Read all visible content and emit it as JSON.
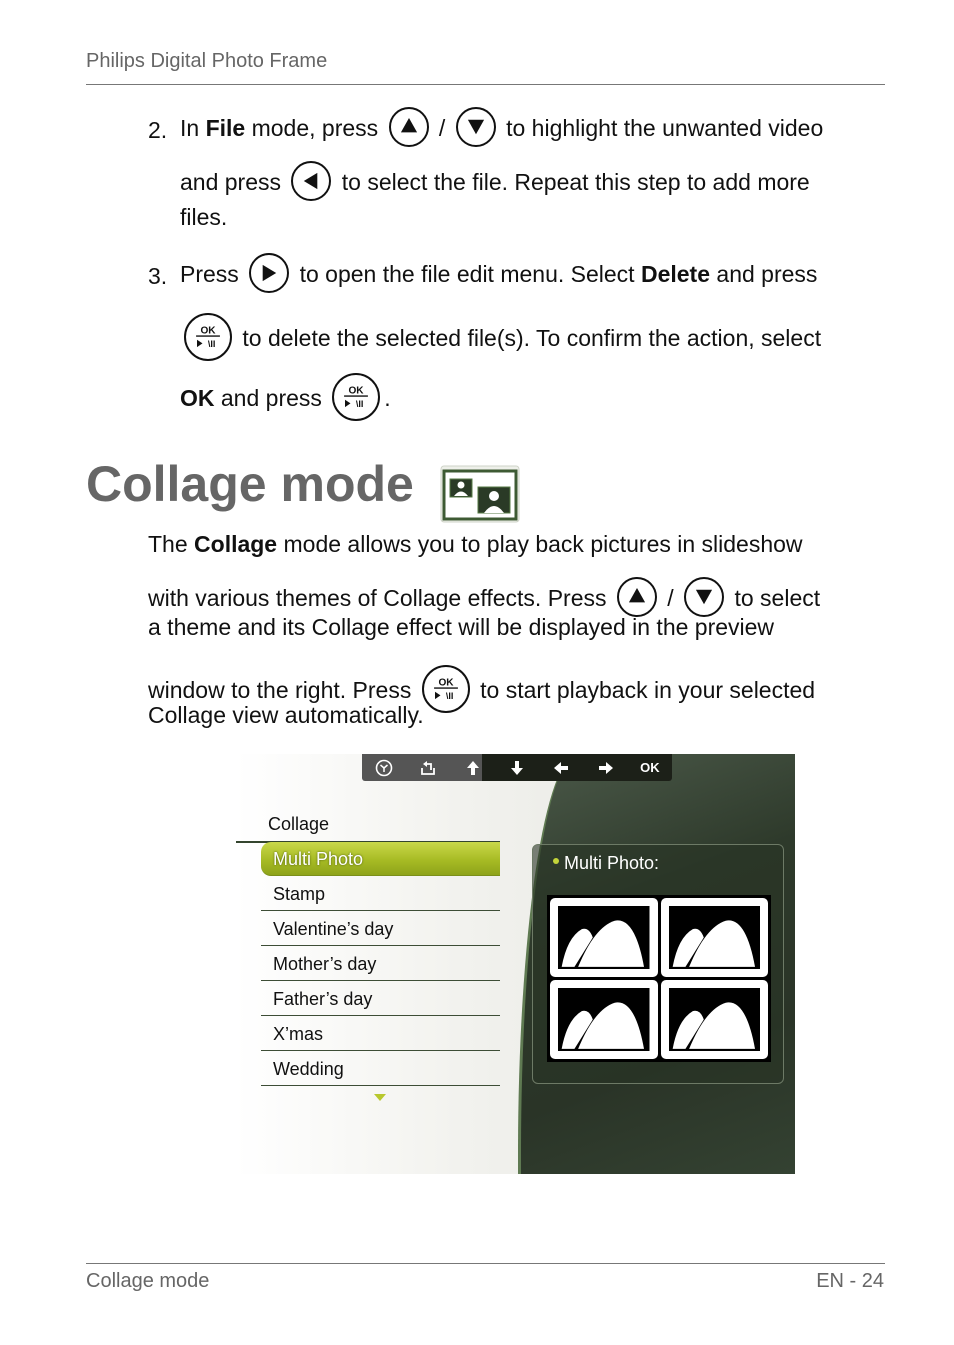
{
  "header": {
    "title": "Philips Digital Photo Frame"
  },
  "steps": [
    {
      "number": "2.",
      "line1": {
        "a": "In ",
        "b_bold": "File",
        "c": " mode, press ",
        "sep": " / ",
        "d": " to highlight the unwanted video"
      },
      "line2": {
        "a": "and press ",
        "b": " to select the file. Repeat this step to add more"
      },
      "line3": "files."
    },
    {
      "number": "3.",
      "line1": {
        "a": "Press ",
        "b": " to open the file edit menu. Select ",
        "c_bold": "Delete",
        "d": " and press"
      },
      "line2": " to delete the selected file(s). To confirm the action, select",
      "line3": {
        "a_bold": "OK",
        "b": " and press ",
        "c": "."
      }
    }
  ],
  "section": {
    "title": "Collage mode",
    "icon": "collage-mode-icon",
    "para": {
      "l1a": "The ",
      "l1b_bold": "Collage",
      "l1c": " mode allows you to play back pictures in slideshow",
      "l2a": "with various themes of Collage effects. Press ",
      "l2sep": " / ",
      "l2b": " to select",
      "l3": "a theme and its Collage effect will be displayed in the preview",
      "l4a": "window to the right. Press ",
      "l4b": " to start playback in your selected",
      "l5": "Collage view automatically."
    }
  },
  "buttons": {
    "up": "up-button-icon",
    "down": "down-button-icon",
    "left": "left-button-icon",
    "right": "right-button-icon",
    "ok_top": "OK",
    "ok_bottom": "▶\\II"
  },
  "screen": {
    "toolbar": {
      "items": [
        "clock-icon",
        "back-icon",
        "up-arrow-icon",
        "down-arrow-icon",
        "left-arrow-icon",
        "right-arrow-icon"
      ],
      "ok_label": "OK"
    },
    "menu_title": "Collage",
    "menu_items": [
      "Multi Photo",
      "Stamp",
      "Valentine’s day",
      "Mother’s day",
      "Father’s day",
      "X’mas",
      "Wedding"
    ],
    "selected_index": 0,
    "preview_label": "Multi Photo:",
    "colors": {
      "accent": "#a7bb24",
      "panel": "#2e3a2b"
    }
  },
  "footer": {
    "left": "Collage mode",
    "right": "EN - 24"
  }
}
